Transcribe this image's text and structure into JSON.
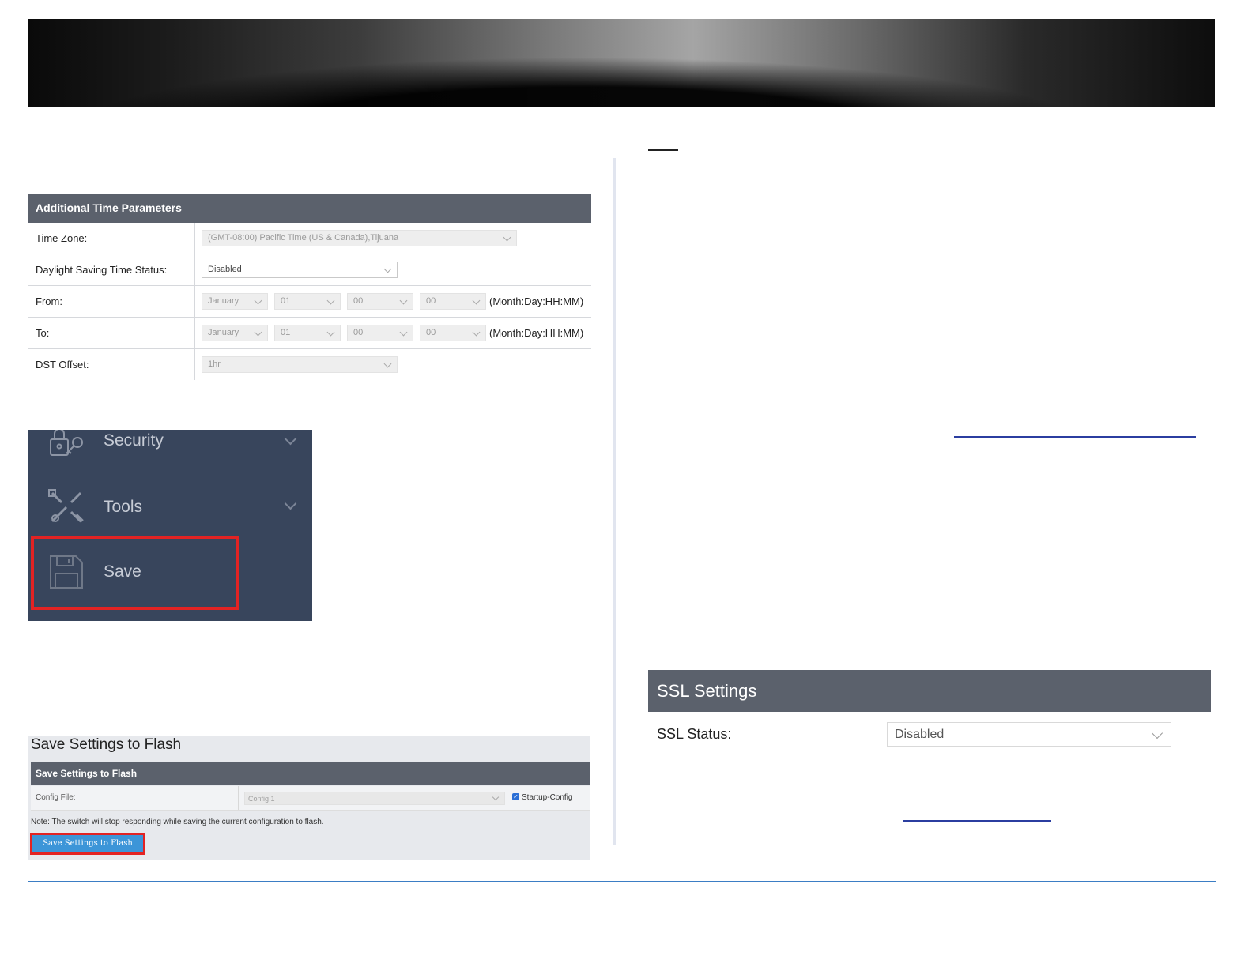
{
  "time_params": {
    "title": "Additional Time Parameters",
    "rows": [
      {
        "label": "Time Zone:",
        "value": "(GMT-08:00) Pacific Time (US & Canada),Tijuana"
      },
      {
        "label": "Daylight Saving Time Status:",
        "value": "Disabled"
      },
      {
        "label": "From:",
        "month": "January",
        "day": "01",
        "hour": "00",
        "minute": "00",
        "unit": "(Month:Day:HH:MM)"
      },
      {
        "label": "To:",
        "month": "January",
        "day": "01",
        "hour": "00",
        "minute": "00",
        "unit": "(Month:Day:HH:MM)"
      },
      {
        "label": "DST Offset:",
        "value": "1hr"
      }
    ]
  },
  "sidebar": {
    "items": [
      {
        "label": "Security",
        "icon": "security-lock-icon"
      },
      {
        "label": "Tools",
        "icon": "tools-icon"
      },
      {
        "label": "Save",
        "icon": "floppy-disk-icon"
      }
    ],
    "highlight_color": "#e32323"
  },
  "save_flash": {
    "page_title": "Save Settings to Flash",
    "panel_title": "Save Settings to Flash",
    "config_label": "Config File:",
    "config_value": "Config 1",
    "checkbox_label": "Startup-Config",
    "checkbox_checked": true,
    "note": "Note: The switch will stop responding while saving the current configuration to flash.",
    "button_label": "Save Settings to Flash"
  },
  "ssl": {
    "title": "SSL Settings",
    "status_label": "SSL Status:",
    "status_value": "Disabled"
  },
  "colors": {
    "panel_header": "#5b616c",
    "sidebar_bg": "#38455c",
    "button_blue": "#3c95d8",
    "footer_line": "#3b7dc4"
  }
}
